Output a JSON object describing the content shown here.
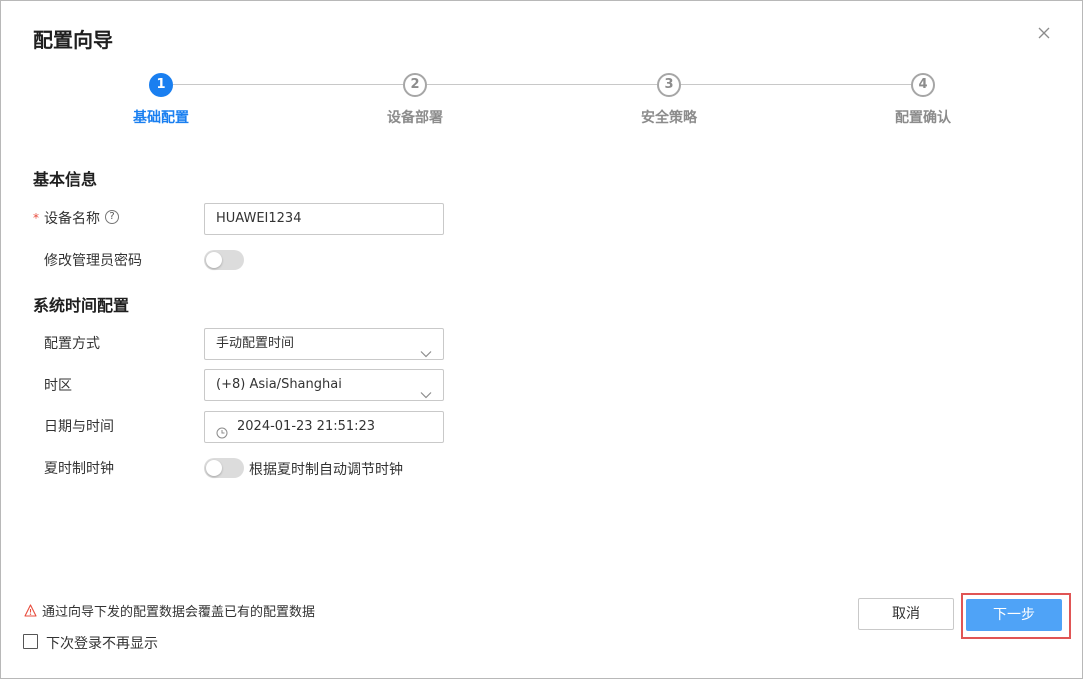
{
  "dialog": {
    "title": "配置向导"
  },
  "steps": [
    {
      "number": "1",
      "label": "基础配置",
      "state": "active"
    },
    {
      "number": "2",
      "label": "设备部署",
      "state": "inactive"
    },
    {
      "number": "3",
      "label": "安全策略",
      "state": "inactive"
    },
    {
      "number": "4",
      "label": "配置确认",
      "state": "inactive"
    }
  ],
  "basic_info": {
    "section_title": "基本信息",
    "device_name_label": "设备名称",
    "required_mark": "*",
    "help_glyph": "?",
    "device_name_value": "HUAWEI1234",
    "change_password_label": "修改管理员密码",
    "change_password_on": false
  },
  "time_config": {
    "section_title": "系统时间配置",
    "method_label": "配置方式",
    "method_value": "手动配置时间",
    "timezone_label": "时区",
    "timezone_value": "(+8) Asia/Shanghai",
    "datetime_label": "日期与时间",
    "datetime_value": "2024-01-23 21:51:23",
    "dst_label": "夏时制时钟",
    "dst_toggle_text": "根据夏时制自动调节时钟",
    "dst_on": false
  },
  "footer": {
    "warning_text": "通过向导下发的配置数据会覆盖已有的配置数据",
    "checkbox_label": "下次登录不再显示",
    "checkbox_checked": false,
    "cancel_label": "取消",
    "next_label": "下一步"
  },
  "colors": {
    "accent": "#1a7ff0",
    "next_button": "#4fa3f7",
    "highlight_border": "#e05555",
    "warning": "#e84c3d"
  },
  "icons": {
    "close": "close-icon",
    "help": "question-circle-icon",
    "chevron": "chevron-down-icon",
    "clock": "clock-icon",
    "warning": "warning-triangle-icon"
  }
}
